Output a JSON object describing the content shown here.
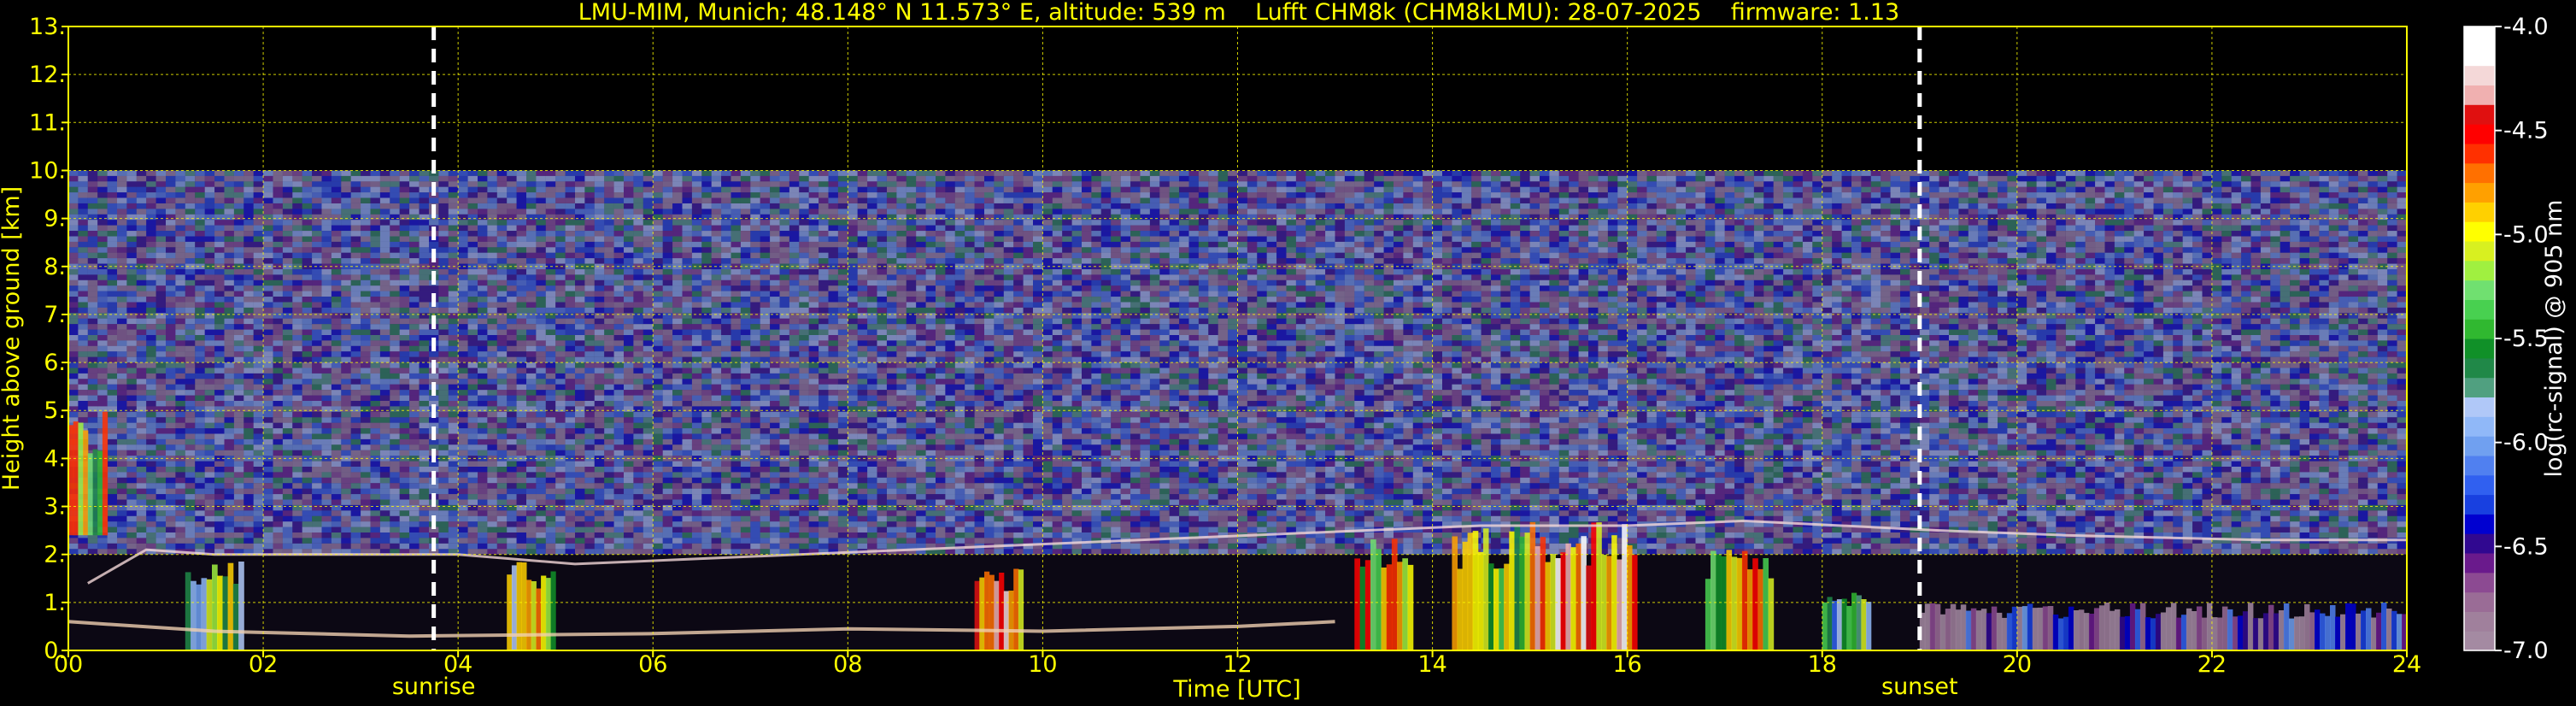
{
  "chart_data": {
    "type": "heatmap",
    "title": "LMU-MIM, Munich; 48.148° N 11.573° E, altitude: 539 m    Lufft CHM8k (CHM8kLMU): 28-07-2025    firmware: 1.13",
    "xlabel": "Time [UTC]",
    "ylabel": "Height above ground [km]",
    "colorbar_label": "log(rc-signal) @ 905 nm",
    "xlim": [
      0,
      24
    ],
    "ylim": [
      0,
      13
    ],
    "x_ticks": [
      "00",
      "02",
      "04",
      "06",
      "08",
      "10",
      "12",
      "14",
      "16",
      "18",
      "20",
      "22",
      "24"
    ],
    "y_ticks": [
      "0.",
      "1.",
      "2.",
      "3.",
      "4.",
      "5.",
      "6.",
      "7.",
      "8.",
      "9.",
      "10.",
      "11.",
      "12.",
      "13."
    ],
    "colorbar_range": [
      -7.0,
      -4.0
    ],
    "colorbar_ticks": [
      "-4.0",
      "-4.5",
      "-5.0",
      "-5.5",
      "-6.0",
      "-6.5",
      "-7.0"
    ],
    "grid": true,
    "data_top_km": 10.0,
    "sunrise": {
      "label": "sunrise",
      "time_h": 3.75
    },
    "sunset": {
      "label": "sunset",
      "time_h": 19.0
    },
    "noise_layer": {
      "from_km": 2.0,
      "to_km": 10.0,
      "level": -6.3
    },
    "cloud_features": [
      {
        "t0": 0.0,
        "t1": 0.4,
        "h0": 2.4,
        "h1": 5.0,
        "level": -5.1
      },
      {
        "t0": 1.2,
        "t1": 1.8,
        "h0": 0.0,
        "h1": 2.0,
        "level": -5.4
      },
      {
        "t0": 4.5,
        "t1": 5.0,
        "h0": 0.0,
        "h1": 1.9,
        "level": -5.3
      },
      {
        "t0": 9.3,
        "t1": 9.8,
        "h0": 0.0,
        "h1": 1.8,
        "level": -4.7
      },
      {
        "t0": 13.2,
        "t1": 13.8,
        "h0": 0.0,
        "h1": 2.4,
        "level": -5.0
      },
      {
        "t0": 14.2,
        "t1": 15.0,
        "h0": 0.0,
        "h1": 2.6,
        "level": -5.2
      },
      {
        "t0": 15.0,
        "t1": 16.1,
        "h0": 0.0,
        "h1": 2.7,
        "level": -4.6
      },
      {
        "t0": 16.8,
        "t1": 17.5,
        "h0": 0.0,
        "h1": 2.2,
        "level": -5.0
      },
      {
        "t0": 18.0,
        "t1": 18.5,
        "h0": 0.0,
        "h1": 1.2,
        "level": -5.6
      },
      {
        "t0": 19.0,
        "t1": 24.0,
        "h0": 0.0,
        "h1": 1.0,
        "level": -6.6
      }
    ],
    "boundary_layer_top": [
      {
        "t": 0.2,
        "h": 1.4
      },
      {
        "t": 0.8,
        "h": 2.1
      },
      {
        "t": 1.5,
        "h": 2.0
      },
      {
        "t": 3.3,
        "h": 2.0
      },
      {
        "t": 4.0,
        "h": 2.0
      },
      {
        "t": 5.2,
        "h": 1.8
      },
      {
        "t": 13.3,
        "h": 2.5
      },
      {
        "t": 14.5,
        "h": 2.6
      },
      {
        "t": 16.0,
        "h": 2.6
      },
      {
        "t": 17.2,
        "h": 2.7
      },
      {
        "t": 19.2,
        "h": 2.5
      },
      {
        "t": 20.5,
        "h": 2.4
      },
      {
        "t": 22.5,
        "h": 2.3
      },
      {
        "t": 24.0,
        "h": 2.3
      }
    ],
    "surface_layer_top": [
      {
        "t": 0.0,
        "h": 0.6
      },
      {
        "t": 1.5,
        "h": 0.4
      },
      {
        "t": 3.5,
        "h": 0.3
      },
      {
        "t": 6.0,
        "h": 0.35
      },
      {
        "t": 8.0,
        "h": 0.45
      },
      {
        "t": 10.0,
        "h": 0.4
      },
      {
        "t": 12.0,
        "h": 0.5
      },
      {
        "t": 13.0,
        "h": 0.6
      }
    ]
  },
  "colorbar_colors": [
    "#a48aa2",
    "#a0809c",
    "#9a6c96",
    "#8c4a92",
    "#6a1a8c",
    "#300890",
    "#0000d0",
    "#1840e0",
    "#3060f0",
    "#5080f0",
    "#70a0f0",
    "#90b8f8",
    "#b0c8f8",
    "#50a080",
    "#208848",
    "#109028",
    "#30b830",
    "#48d050",
    "#70e070",
    "#a0f040",
    "#d8f020",
    "#ffff00",
    "#ffd000",
    "#ffa000",
    "#ff7000",
    "#ff3000",
    "#ff0000",
    "#e01010",
    "#f0b0b0",
    "#f4d8d8",
    "#ffffff",
    "#ffffff"
  ],
  "style": {
    "text_color": "#ffff00",
    "grid_color": "#ffff00",
    "background": "#000000"
  }
}
